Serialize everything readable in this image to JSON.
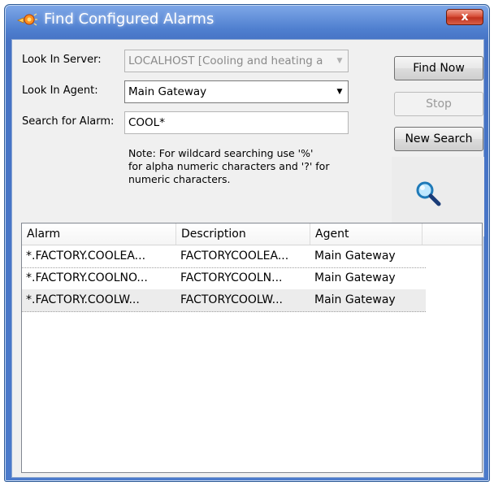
{
  "window": {
    "title": "Find Configured Alarms",
    "close_label": "x"
  },
  "form": {
    "server_label": "Look In Server:",
    "server_value": "LOCALHOST [Cooling and heating a",
    "agent_label": "Look In Agent:",
    "agent_value": "Main Gateway",
    "alarm_label": "Search for Alarm:",
    "alarm_value": "COOL*",
    "note_line1": "Note: For wildcard searching use '%'",
    "note_line2": "for alpha numeric characters and '?' for",
    "note_line3": "numeric characters."
  },
  "buttons": {
    "find_now": "Find Now",
    "stop": "Stop",
    "new_search": "New Search"
  },
  "results": {
    "columns": [
      "Alarm",
      "Description",
      "Agent"
    ],
    "rows": [
      [
        "*.FACTORY.COOLEA...",
        "FACTORYCOOLEA...",
        "Main Gateway"
      ],
      [
        "*.FACTORY.COOLNO...",
        "FACTORYCOOLN...",
        "Main Gateway"
      ],
      [
        "*.FACTORY.COOLW...",
        "FACTORYCOOLW...",
        "Main Gateway"
      ]
    ]
  },
  "icons": {
    "app": "alarm-bell-icon",
    "search": "magnifier-icon"
  },
  "colors": {
    "titlebar": "#4572c4",
    "close_button": "#c0321e",
    "selected_row": "#ececec"
  }
}
